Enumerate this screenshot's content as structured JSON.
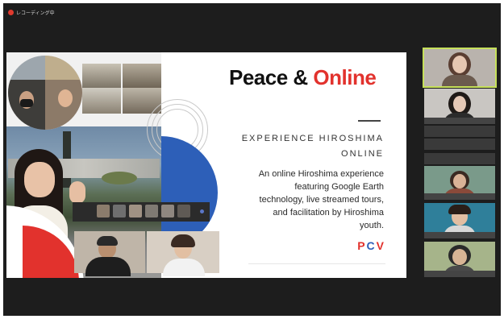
{
  "recording": {
    "label": "レコーディング中",
    "dot_color": "#e03a2e"
  },
  "slide": {
    "title_part1": "Peace & ",
    "title_part2": "Online",
    "subtitle_line1": "EXPERIENCE HIROSHIMA",
    "subtitle_line2": "ONLINE",
    "description_lines": [
      "An online Hiroshima experience",
      "featuring Google Earth",
      "technology, live streamed tours,",
      "and facilitation by Hiroshima",
      "youth."
    ],
    "logo_letters": [
      "P",
      "C",
      "V"
    ],
    "colors": {
      "accent_red": "#e2322d",
      "accent_blue": "#2d5fb8"
    }
  },
  "participants": [
    {
      "label": "participant-1",
      "active": true
    },
    {
      "label": "participant-2",
      "active": false
    },
    {
      "label": "participant-3",
      "active": false
    },
    {
      "label": "participant-4",
      "active": false
    },
    {
      "label": "participant-5",
      "active": false
    },
    {
      "label": "participant-6",
      "active": false
    },
    {
      "label": "participant-7",
      "active": false
    }
  ]
}
